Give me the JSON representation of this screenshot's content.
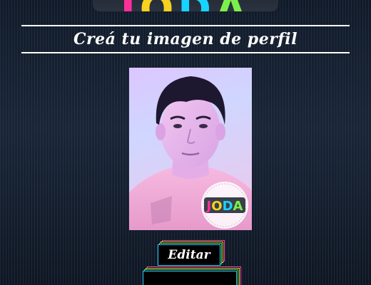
{
  "logo": {
    "letters": [
      "J",
      "O",
      "D",
      "A"
    ],
    "letter_colors": [
      "#ff2f9a",
      "#f7d21f",
      "#18d3ff",
      "#7cf04a"
    ]
  },
  "header": {
    "title": "Creá tu imagen de perfil"
  },
  "profile": {
    "photo_icon": "user-photo",
    "badge": {
      "icon": "joda-badge",
      "small_text": "",
      "letters": [
        "J",
        "O",
        "D",
        "A"
      ]
    }
  },
  "actions": {
    "edit_label": "Editar",
    "second_label": ""
  },
  "colors": {
    "accent_pink": "#ff4fb0",
    "accent_yellow": "#ffd34f",
    "accent_green": "#4fe07a",
    "accent_cyan": "#2fd0ff"
  }
}
